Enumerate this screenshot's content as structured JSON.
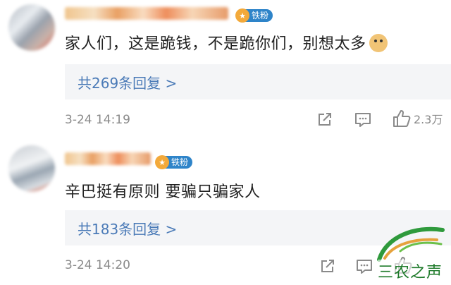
{
  "comments": [
    {
      "badge_label": "铁粉",
      "text": "家人们，这是跪钱，不是跪你们，别想太多",
      "replies_label": "共269条回复 >",
      "timestamp": "3-24 14:19",
      "like_count": "2.3万",
      "has_emoji": "doge"
    },
    {
      "badge_label": "铁粉",
      "text": "辛巴挺有原则 要骗只骗家人",
      "replies_label": "共183条回复 >",
      "timestamp": "3-24 14:20",
      "like_count": ""
    }
  ],
  "watermark": {
    "text": "三农之声"
  },
  "colors": {
    "reply_link": "#4a7ab7",
    "badge_blue": "#2e84c9",
    "badge_medal": "#f3a93a",
    "watermark_green": "#1e7a2a"
  }
}
